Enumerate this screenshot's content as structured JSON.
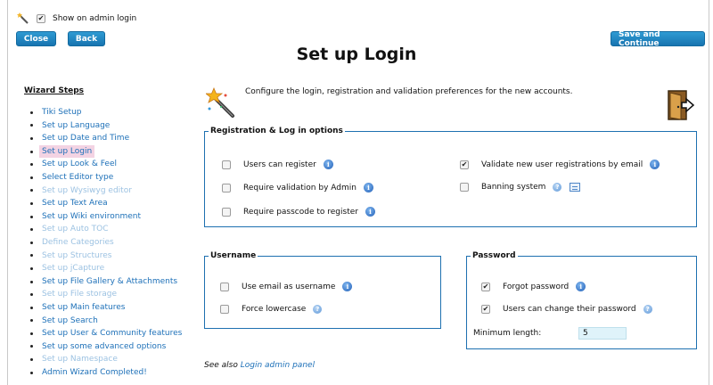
{
  "topbar": {
    "show_on_admin_login": "Show on admin login",
    "checked": true
  },
  "buttons": {
    "close": "Close",
    "back": "Back",
    "save_continue": "Save and Continue"
  },
  "page_title": "Set up Login",
  "sidebar": {
    "title": "Wizard Steps",
    "items": [
      {
        "label": "Tiki Setup",
        "state": "enabled"
      },
      {
        "label": "Set up Language",
        "state": "enabled"
      },
      {
        "label": "Set up Date and Time",
        "state": "enabled"
      },
      {
        "label": "Set up Login",
        "state": "current"
      },
      {
        "label": "Set up Look & Feel",
        "state": "enabled"
      },
      {
        "label": "Select Editor type",
        "state": "enabled"
      },
      {
        "label": "Set up Wysiwyg editor",
        "state": "disabled"
      },
      {
        "label": "Set up Text Area",
        "state": "enabled"
      },
      {
        "label": "Set up Wiki environment",
        "state": "enabled"
      },
      {
        "label": "Set up Auto TOC",
        "state": "disabled"
      },
      {
        "label": "Define Categories",
        "state": "disabled"
      },
      {
        "label": "Set up Structures",
        "state": "disabled"
      },
      {
        "label": "Set up jCapture",
        "state": "disabled"
      },
      {
        "label": "Set up File Gallery & Attachments",
        "state": "enabled"
      },
      {
        "label": "Set up File storage",
        "state": "disabled"
      },
      {
        "label": "Set up Main features",
        "state": "enabled"
      },
      {
        "label": "Set up Search",
        "state": "enabled"
      },
      {
        "label": "Set up User & Community features",
        "state": "enabled"
      },
      {
        "label": "Set up some advanced options",
        "state": "enabled"
      },
      {
        "label": "Set up Namespace",
        "state": "disabled"
      },
      {
        "label": "Admin Wizard Completed!",
        "state": "enabled"
      }
    ]
  },
  "intro": "Configure the login, registration and validation preferences for the new accounts.",
  "registration": {
    "legend": "Registration & Log in options",
    "users_can_register": {
      "label": "Users can register",
      "checked": false
    },
    "require_validation_admin": {
      "label": "Require validation by Admin",
      "checked": false
    },
    "require_passcode": {
      "label": "Require passcode to register",
      "checked": false
    },
    "validate_email": {
      "label": "Validate new user registrations by email",
      "checked": true
    },
    "banning_system": {
      "label": "Banning system",
      "checked": false
    }
  },
  "username": {
    "legend": "Username",
    "use_email": {
      "label": "Use email as username",
      "checked": false
    },
    "force_lowercase": {
      "label": "Force lowercase",
      "checked": false
    }
  },
  "password": {
    "legend": "Password",
    "forgot": {
      "label": "Forgot password",
      "checked": true
    },
    "users_change": {
      "label": "Users can change their password",
      "checked": true
    },
    "min_length_label": "Minimum length:",
    "min_length_value": "5"
  },
  "see_also": {
    "prefix": "See also",
    "link": "Login admin panel"
  },
  "colors": {
    "accent": "#1d70b8",
    "button": "#1874b0",
    "current_highlight": "#f3d3e3",
    "fieldset_border": "#1e70b0"
  }
}
